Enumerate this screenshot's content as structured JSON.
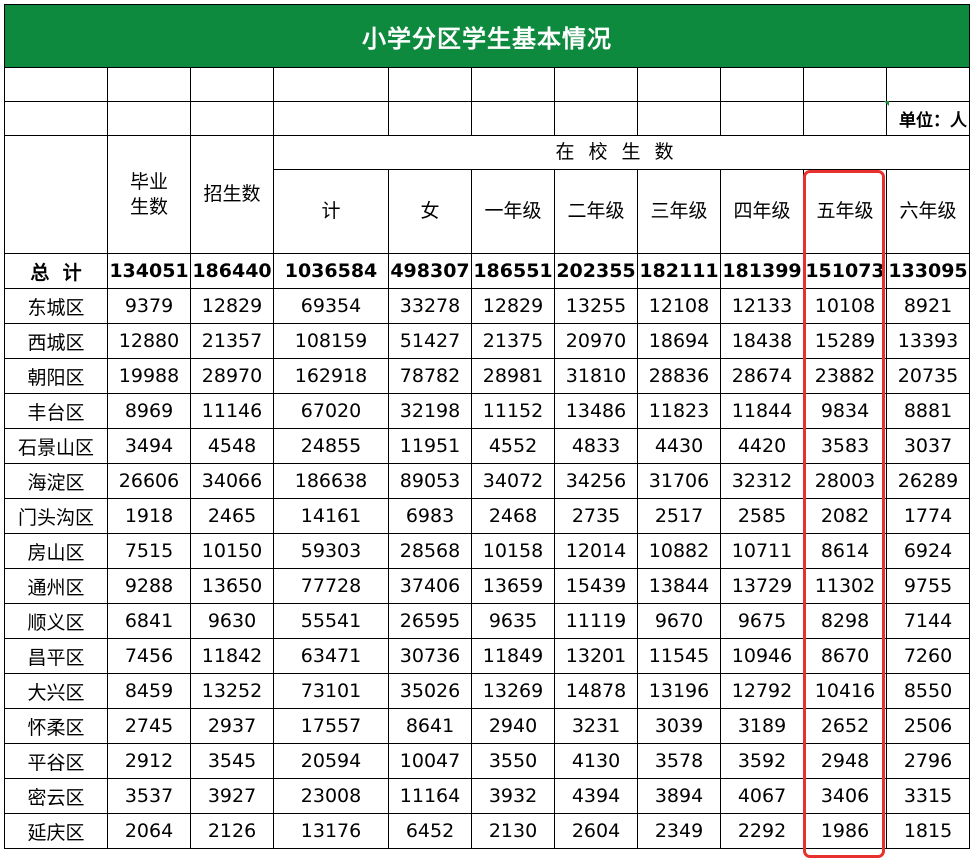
{
  "title": "小学分区学生基本情况",
  "unit": "单位：人",
  "accent_color": "#0d8a3e",
  "highlight_color": "#e8312d",
  "highlight_column": "五年级",
  "headers": {
    "graduates": "毕业\n生数",
    "enrolled": "招生数",
    "in_school": "在校生数",
    "sub": [
      "计",
      "女",
      "一年级",
      "二年级",
      "三年级",
      "四年级",
      "五年级",
      "六年级"
    ]
  },
  "rows": [
    [
      "总  计",
      "134051",
      "186440",
      "1036584",
      "498307",
      "186551",
      "202355",
      "182111",
      "181399",
      "151073",
      "133095"
    ],
    [
      "东城区",
      "9379",
      "12829",
      "69354",
      "33278",
      "12829",
      "13255",
      "12108",
      "12133",
      "10108",
      "8921"
    ],
    [
      "西城区",
      "12880",
      "21357",
      "108159",
      "51427",
      "21375",
      "20970",
      "18694",
      "18438",
      "15289",
      "13393"
    ],
    [
      "朝阳区",
      "19988",
      "28970",
      "162918",
      "78782",
      "28981",
      "31810",
      "28836",
      "28674",
      "23882",
      "20735"
    ],
    [
      "丰台区",
      "8969",
      "11146",
      "67020",
      "32198",
      "11152",
      "13486",
      "11823",
      "11844",
      "9834",
      "8881"
    ],
    [
      "石景山区",
      "3494",
      "4548",
      "24855",
      "11951",
      "4552",
      "4833",
      "4430",
      "4420",
      "3583",
      "3037"
    ],
    [
      "海淀区",
      "26606",
      "34066",
      "186638",
      "89053",
      "34072",
      "34256",
      "31706",
      "32312",
      "28003",
      "26289"
    ],
    [
      "门头沟区",
      "1918",
      "2465",
      "14161",
      "6983",
      "2468",
      "2735",
      "2517",
      "2585",
      "2082",
      "1774"
    ],
    [
      "房山区",
      "7515",
      "10150",
      "59303",
      "28568",
      "10158",
      "12014",
      "10882",
      "10711",
      "8614",
      "6924"
    ],
    [
      "通州区",
      "9288",
      "13650",
      "77728",
      "37406",
      "13659",
      "15439",
      "13844",
      "13729",
      "11302",
      "9755"
    ],
    [
      "顺义区",
      "6841",
      "9630",
      "55541",
      "26595",
      "9635",
      "11119",
      "9670",
      "9675",
      "8298",
      "7144"
    ],
    [
      "昌平区",
      "7456",
      "11842",
      "63471",
      "30736",
      "11849",
      "13201",
      "11545",
      "10946",
      "8670",
      "7260"
    ],
    [
      "大兴区",
      "8459",
      "13252",
      "73101",
      "35026",
      "13269",
      "14878",
      "13196",
      "12792",
      "10416",
      "8550"
    ],
    [
      "怀柔区",
      "2745",
      "2937",
      "17557",
      "8641",
      "2940",
      "3231",
      "3039",
      "3189",
      "2652",
      "2506"
    ],
    [
      "平谷区",
      "2912",
      "3545",
      "20594",
      "10047",
      "3550",
      "4130",
      "3578",
      "3592",
      "2948",
      "2796"
    ],
    [
      "密云区",
      "3537",
      "3927",
      "23008",
      "11164",
      "3932",
      "4394",
      "3894",
      "4067",
      "3406",
      "3315"
    ],
    [
      "延庆区",
      "2064",
      "2126",
      "13176",
      "6452",
      "2130",
      "2604",
      "2349",
      "2292",
      "1986",
      "1815"
    ]
  ]
}
